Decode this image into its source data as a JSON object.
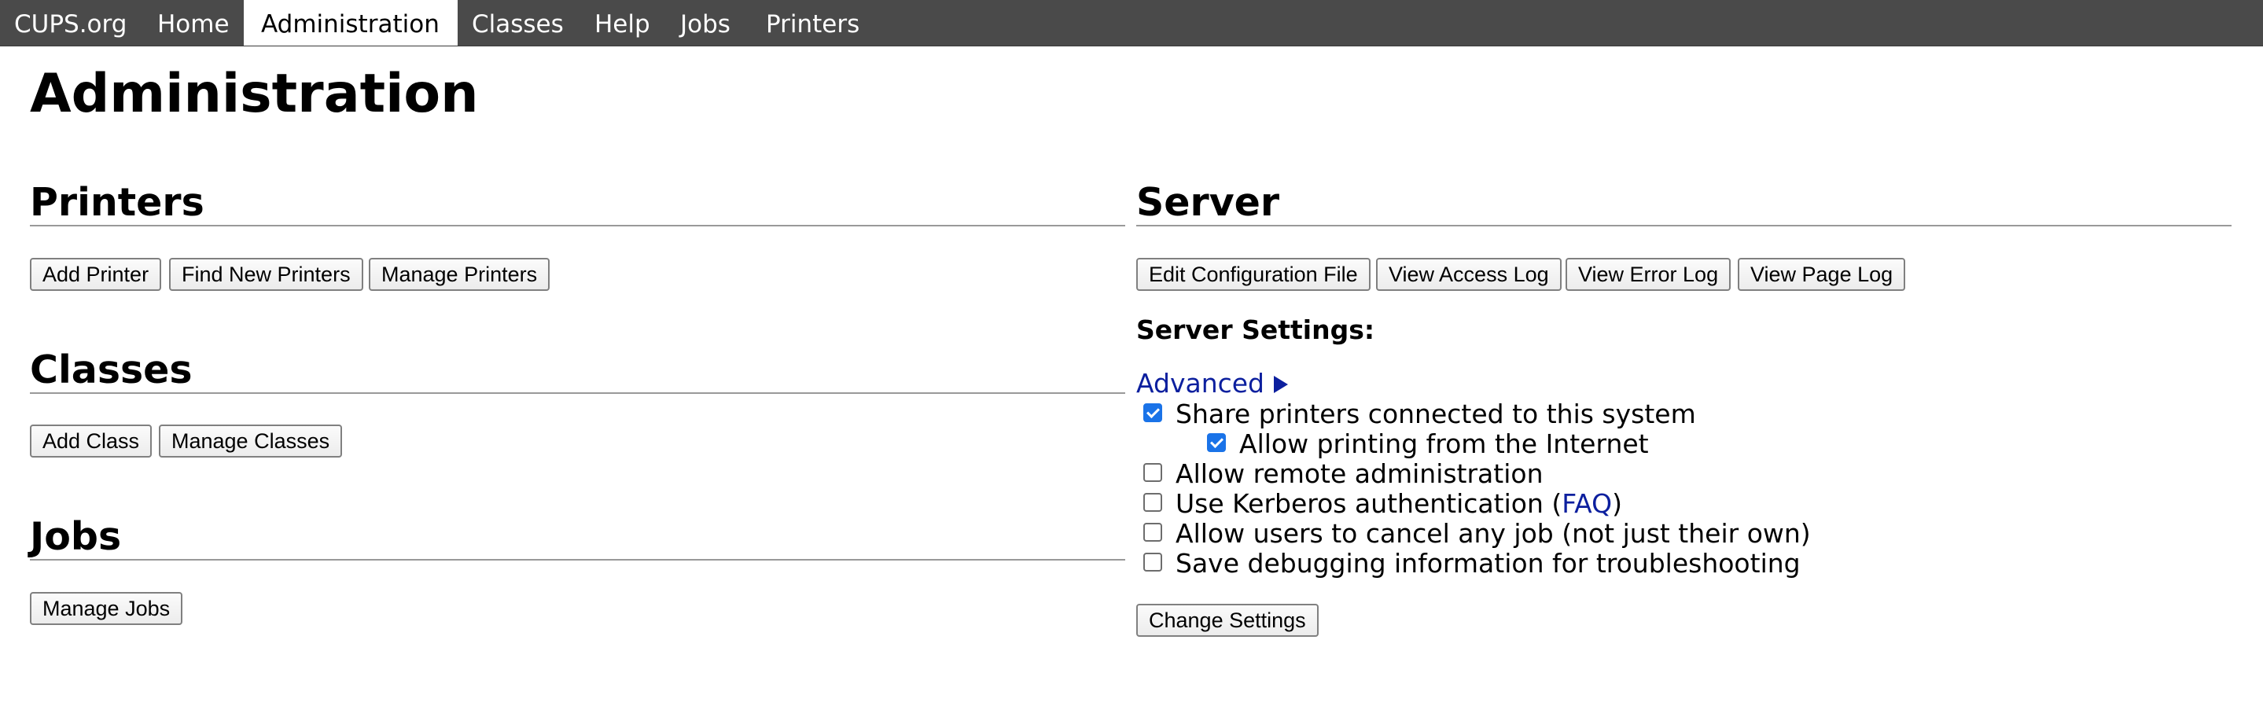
{
  "nav": {
    "items": [
      {
        "label": "CUPS.org",
        "active": false
      },
      {
        "label": "Home",
        "active": false
      },
      {
        "label": "Administration",
        "active": true
      },
      {
        "label": "Classes",
        "active": false
      },
      {
        "label": "Help",
        "active": false
      },
      {
        "label": "Jobs",
        "active": false
      },
      {
        "label": "Printers",
        "active": false
      }
    ]
  },
  "page": {
    "title": "Administration"
  },
  "printers": {
    "heading": "Printers",
    "buttons": [
      "Add Printer",
      "Find New Printers",
      "Manage Printers"
    ]
  },
  "classes": {
    "heading": "Classes",
    "buttons": [
      "Add Class",
      "Manage Classes"
    ]
  },
  "jobs": {
    "heading": "Jobs",
    "buttons": [
      "Manage Jobs"
    ]
  },
  "server": {
    "heading": "Server",
    "buttons": [
      "Edit Configuration File",
      "View Access Log",
      "View Error Log",
      "View Page Log"
    ],
    "settings_label": "Server Settings:",
    "advanced_label": "Advanced",
    "options": [
      {
        "label": "Share printers connected to this system",
        "checked": true
      },
      {
        "label": "Allow printing from the Internet",
        "checked": true
      },
      {
        "label": "Allow remote administration",
        "checked": false
      },
      {
        "label_before": "Use Kerberos authentication (",
        "link": "FAQ",
        "label_after": ")",
        "checked": false
      },
      {
        "label": "Allow users to cancel any job (not just their own)",
        "checked": false
      },
      {
        "label": "Save debugging information for troubleshooting",
        "checked": false
      }
    ],
    "change_button": "Change Settings"
  },
  "colors": {
    "topbar": "#4a4a4a",
    "link": "#0c1f9e",
    "checkbox_checked": "#1a73e8"
  }
}
